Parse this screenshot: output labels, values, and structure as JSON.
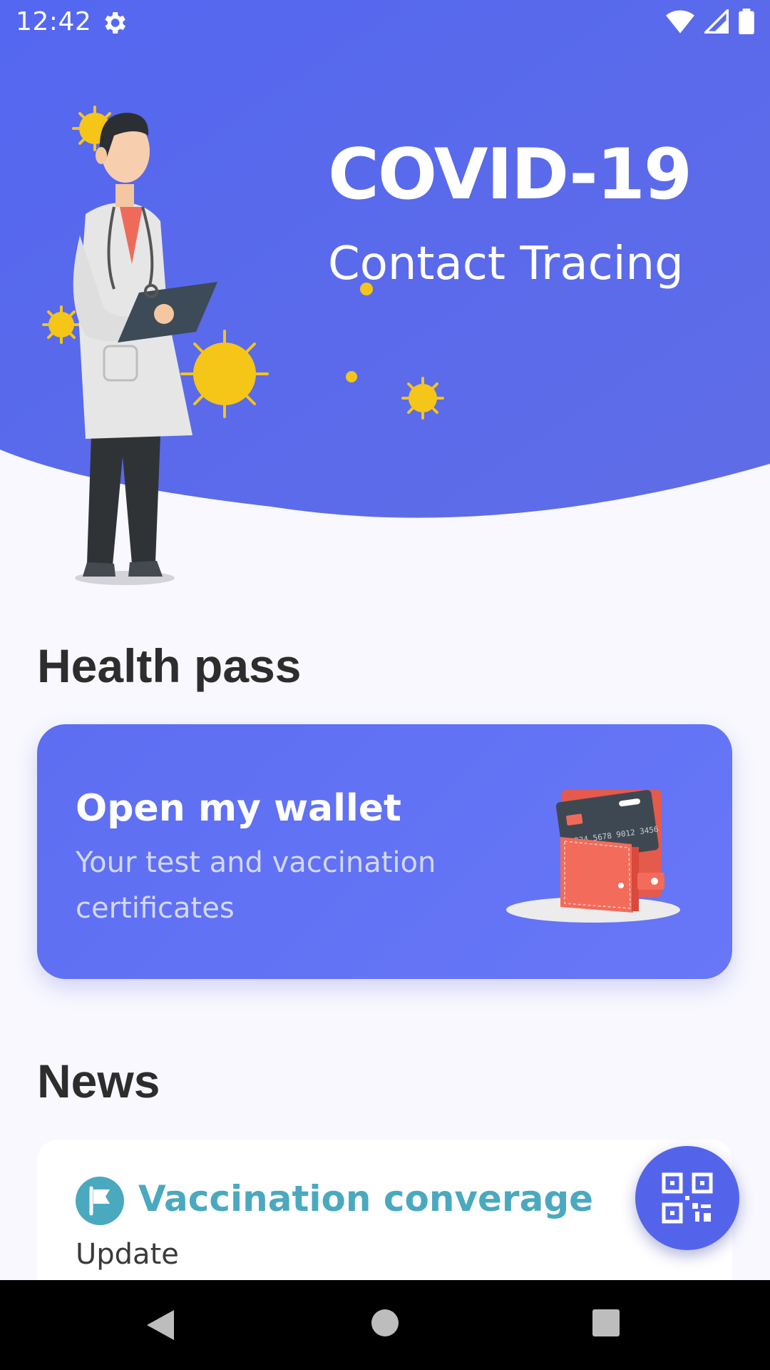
{
  "status_bar": {
    "time": "12:42"
  },
  "hero": {
    "title": "COVID-19",
    "subtitle": "Contact Tracing"
  },
  "health_pass": {
    "section_title": "Health pass",
    "card_title": "Open my wallet",
    "card_subtitle": "Your test and vaccination certificates",
    "card_number": "1234 5678 9012 3456"
  },
  "news": {
    "section_title": "News",
    "item_title": "Vaccination converage",
    "item_subtitle": "Update"
  },
  "colors": {
    "hero_blue": "#5a67ee",
    "card_blue": "#6676f6",
    "news_teal": "#4aa9bf",
    "fab_blue": "#5464ea",
    "virus_yellow": "#f5c518"
  }
}
